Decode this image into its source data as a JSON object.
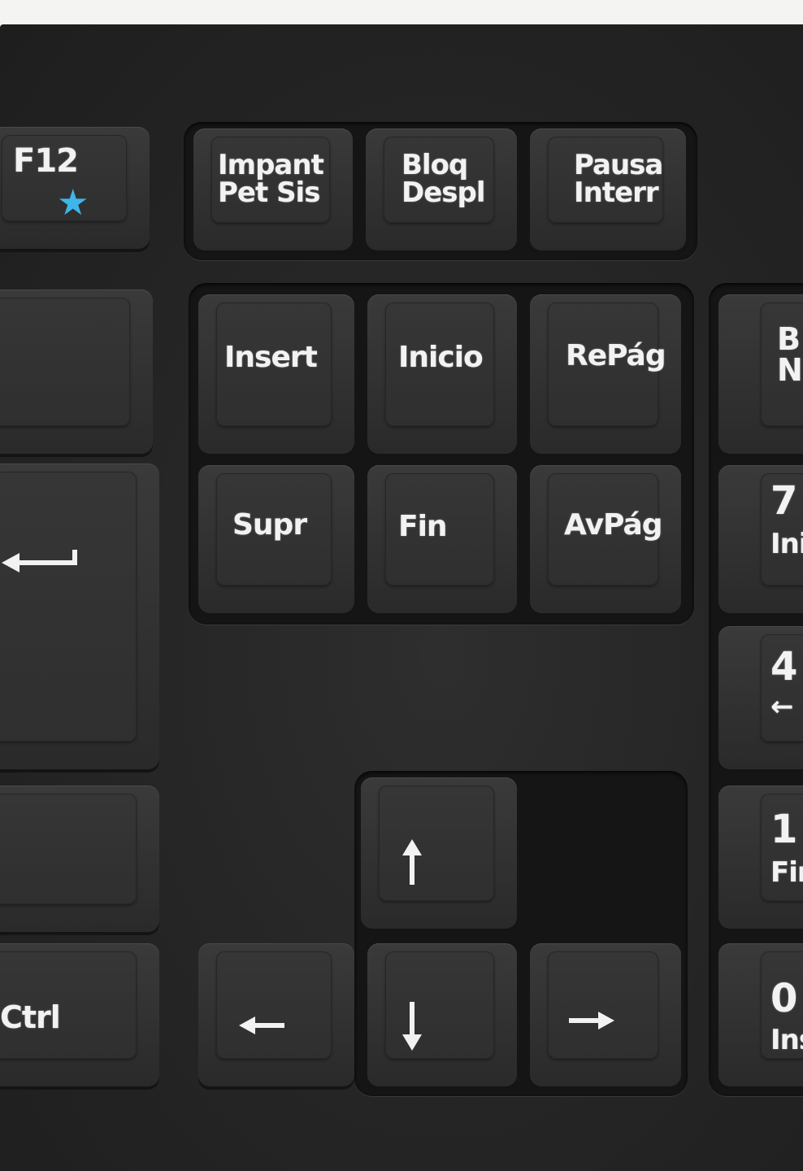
{
  "keys": {
    "f12": "F12",
    "print_screen": [
      "Impant",
      "Pet Sis"
    ],
    "scroll_lock": [
      "Bloq",
      "Despl"
    ],
    "pause": [
      "Pausa",
      "Interr"
    ],
    "insert": "Insert",
    "home": "Inicio",
    "page_up": "RePág",
    "delete": "Supr",
    "end": "Fin",
    "page_down": "AvPág",
    "ctrl": "Ctrl",
    "numpad": {
      "top_partial": [
        "B",
        "N"
      ],
      "seven": [
        "7",
        "Ini"
      ],
      "four": [
        "4",
        "←"
      ],
      "one": [
        "1",
        "Fin"
      ],
      "zero": [
        "0",
        "Ins"
      ]
    }
  },
  "icons": {
    "f12_star": "star-icon",
    "enter": "enter-arrow-icon",
    "up": "arrow-up-icon",
    "down": "arrow-down-icon",
    "left": "arrow-left-icon",
    "right": "arrow-right-icon"
  },
  "colors": {
    "key": "#2f2f2f",
    "legend": "#f2f2f2",
    "star": "#3fb6e9"
  }
}
